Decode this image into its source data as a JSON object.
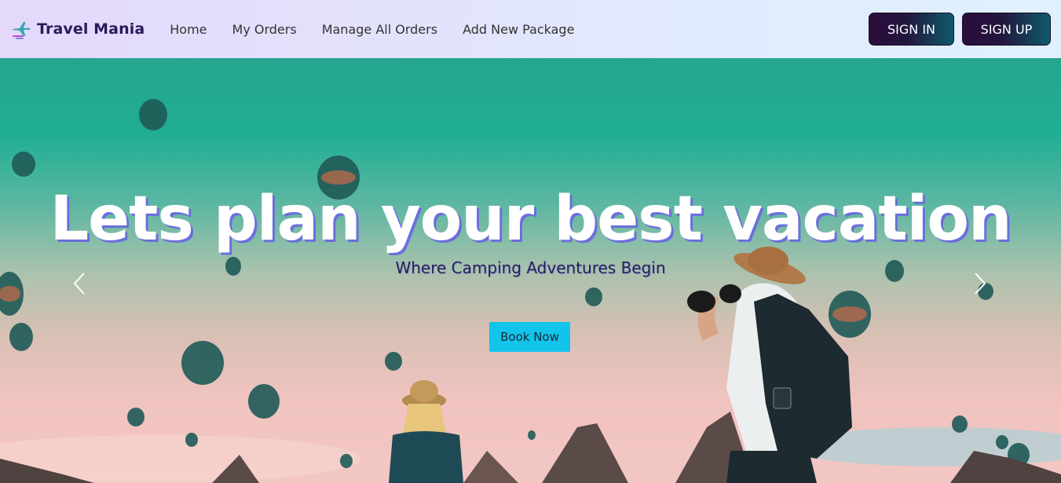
{
  "brand": {
    "name": "Travel Mania",
    "icon": "plane-icon"
  },
  "nav": {
    "links": [
      {
        "label": "Home"
      },
      {
        "label": "My Orders"
      },
      {
        "label": "Manage All Orders"
      },
      {
        "label": "Add New Package"
      }
    ]
  },
  "auth": {
    "signin_label": "SIGN IN",
    "signup_label": "SIGN UP"
  },
  "hero": {
    "title": "Lets plan your best vacation",
    "subtitle": "Where Camping Adventures Begin",
    "cta_label": "Book Now",
    "prev_icon": "chevron-left-icon",
    "next_icon": "chevron-right-icon"
  },
  "colors": {
    "brand_text": "#2b1a5a",
    "cta_bg": "#11c4ea",
    "auth_gradient_start": "#2a0d3c",
    "auth_gradient_end": "#0e5a6a",
    "title_shadow": "#6b6fdc"
  }
}
